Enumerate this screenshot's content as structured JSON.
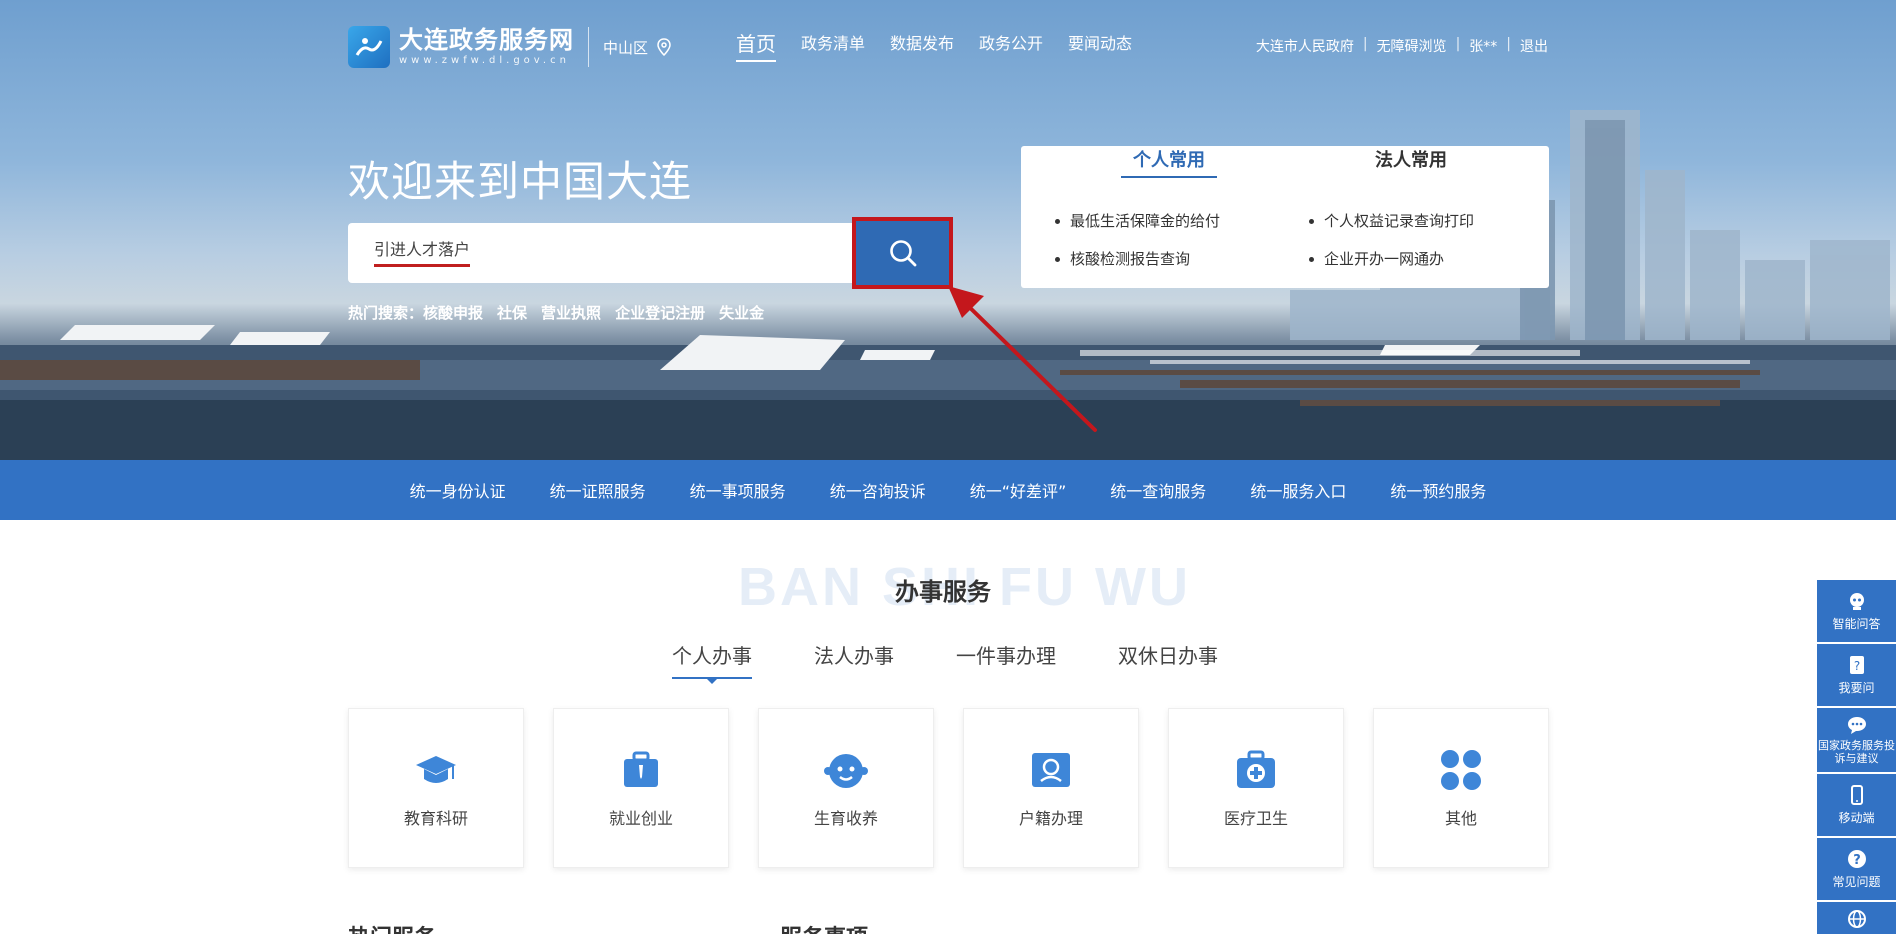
{
  "header": {
    "logo_title": "大连政务服务网",
    "logo_url": "www.zwfw.dl.gov.cn",
    "district": "中山区",
    "nav": [
      "首页",
      "政务清单",
      "数据发布",
      "政务公开",
      "要闻动态"
    ],
    "top_links": [
      "大连市人民政府",
      "无障碍浏览",
      "张**",
      "退出"
    ]
  },
  "hero": {
    "welcome": "欢迎来到中国大连",
    "search_value": "引进人才落户",
    "hot_label": "热门搜索：",
    "hot_items": [
      "核酸申报",
      "社保",
      "营业执照",
      "企业登记注册",
      "失业金"
    ]
  },
  "common_card": {
    "tab_personal": "个人常用",
    "tab_legal": "法人常用",
    "personal_items": [
      "最低生活保障金的给付",
      "核酸检测报告查询"
    ],
    "legal_items": [
      "个人权益记录查询打印",
      "企业开办一网通办"
    ]
  },
  "service_bar": [
    "统一身份认证",
    "统一证照服务",
    "统一事项服务",
    "统一咨询投诉",
    "统一“好差评”",
    "统一查询服务",
    "统一服务入口",
    "统一预约服务"
  ],
  "section": {
    "bg_text": "BAN SHI FU WU",
    "title": "办事服务",
    "tabs": [
      "个人办事",
      "法人办事",
      "一件事办理",
      "双休日办事"
    ],
    "tiles": [
      {
        "label": "教育科研",
        "icon": "graduation-cap-icon"
      },
      {
        "label": "就业创业",
        "icon": "briefcase-icon"
      },
      {
        "label": "生育收养",
        "icon": "baby-face-icon"
      },
      {
        "label": "户籍办理",
        "icon": "id-card-icon"
      },
      {
        "label": "医疗卫生",
        "icon": "medical-kit-icon"
      },
      {
        "label": "其他",
        "icon": "clover-icon"
      }
    ],
    "hot_services": "热门服务",
    "service_items": "服务事项"
  },
  "float_panel": [
    "智能问答",
    "我要问",
    "国家政务服务投诉与建议",
    "移动端",
    "常见问题"
  ],
  "colors": {
    "primary": "#3272c4",
    "highlight": "#c4171c"
  }
}
